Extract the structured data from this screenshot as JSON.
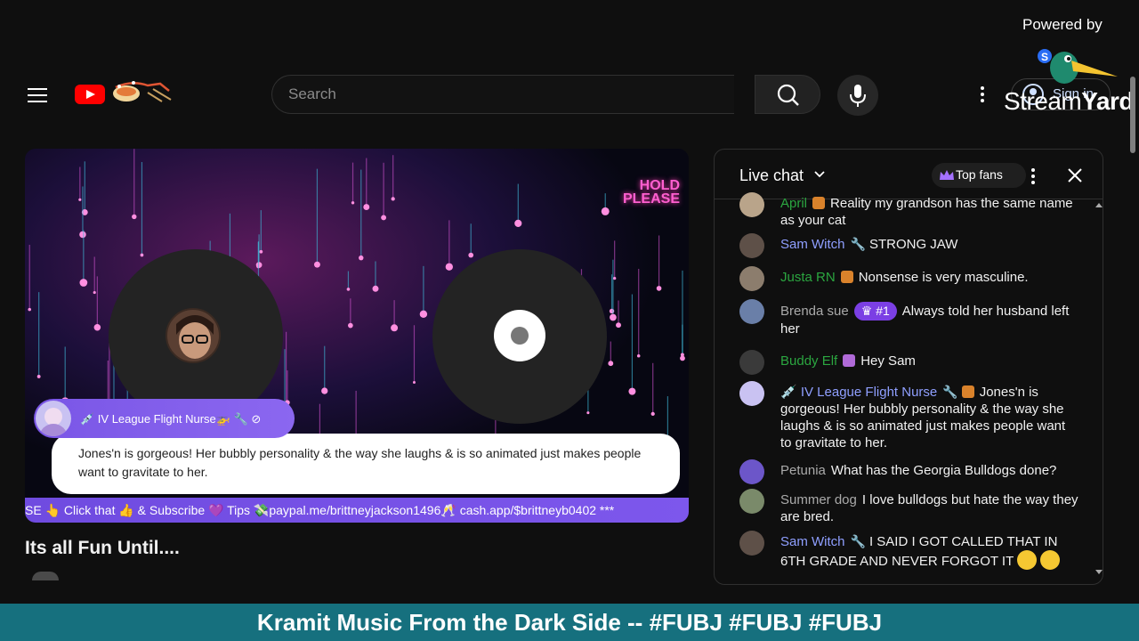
{
  "header": {
    "search": {
      "placeholder": "Search"
    },
    "sign_in_label": "Sign in"
  },
  "overlay": {
    "powered_by": "Powered by",
    "brand_light": "Stream",
    "brand_bold": "Yard"
  },
  "video": {
    "hold_line1": "HOLD",
    "hold_line2": "PLEASE",
    "highlight": {
      "author": "💉 IV League Flight Nurse🚁 🔧 ⊘",
      "text": "Jones'n is gorgeous! Her bubbly personality & the way she laughs & is so animated just makes people want to gravitate to her."
    },
    "ticker": "SE 👆 Click that 👍 & Subscribe 💜 Tips 💸paypal.me/brittneyjackson1496🥂 cash.app/$brittneyb0402 ***",
    "title": "Its all Fun Until...."
  },
  "chat": {
    "title": "Live chat",
    "top_fans": "Top fans",
    "messages": [
      {
        "author": "April",
        "text": "Reality my grandson has the same name as your cat"
      },
      {
        "author": "Sam Witch",
        "badge": "🔧",
        "text": "STRONG JAW"
      },
      {
        "author": "Justa RN",
        "text": "Nonsense is very masculine."
      },
      {
        "author": "Brenda sue",
        "rank": "#1",
        "text": "Always told her husband left her"
      },
      {
        "author": "Buddy Elf",
        "text": "Hey Sam"
      },
      {
        "author": "💉 IV League Flight Nurse",
        "badge": "🔧",
        "text": "Jones'n is gorgeous! Her bubbly personality & the way she laughs & is so animated just makes people want to gravitate to her."
      },
      {
        "author": "Petunia",
        "text": "What has the Georgia Bulldogs done?"
      },
      {
        "author": "Summer dog",
        "text": "I love bulldogs but hate the way they are bred."
      },
      {
        "author": "Sam Witch",
        "badge": "🔧",
        "text": "I SAID I GOT CALLED THAT IN 6TH GRADE AND NEVER FORGOT IT"
      }
    ]
  },
  "banner": {
    "text": "Kramit Music From the Dark Side -- #FUBJ #FUBJ #FUBJ"
  },
  "colors": {
    "background": "#0f0f0f",
    "accent_red": "#ff0000",
    "author_green": "#2ba640",
    "author_blue": "#8f9fff",
    "rank_purple": "#7b3fe4",
    "banner_teal": "#16707e"
  },
  "icons": [
    "menu-icon",
    "youtube-logo",
    "search-icon",
    "mic-icon",
    "more-vert-icon",
    "account-icon",
    "chevron-down-icon",
    "crown-icon",
    "close-icon",
    "wrench-icon"
  ]
}
